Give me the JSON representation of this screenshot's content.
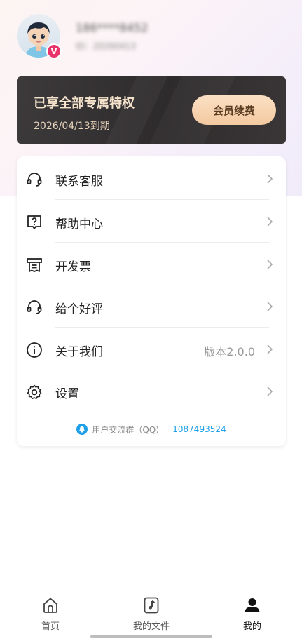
{
  "profile": {
    "username": "186****8452",
    "user_id": "ID：20260413",
    "vip_badge": "V"
  },
  "member_card": {
    "title": "已享全部专属特权",
    "expire": "2026/04/13到期",
    "renew_label": "会员续费"
  },
  "menu": {
    "items": [
      {
        "label": "联系客服",
        "icon": "headset-icon"
      },
      {
        "label": "帮助中心",
        "icon": "help-icon"
      },
      {
        "label": "开发票",
        "icon": "invoice-icon"
      },
      {
        "label": "给个好评",
        "icon": "headset-icon"
      },
      {
        "label": "关于我们",
        "icon": "info-icon",
        "value": "版本2.0.0"
      },
      {
        "label": "设置",
        "icon": "gear-icon"
      }
    ],
    "qq_group_label": "用户交流群（QQ）",
    "qq_group_number": "1087493524"
  },
  "bottom_nav": {
    "items": [
      {
        "label": "首页",
        "icon": "home-icon",
        "active": false
      },
      {
        "label": "我的文件",
        "icon": "music-file-icon",
        "active": false
      },
      {
        "label": "我的",
        "icon": "user-icon",
        "active": true
      }
    ]
  },
  "colors": {
    "accent_blue": "#1da0e8",
    "vip_pink": "#e8336b",
    "card_dark": "#332f30",
    "gold_text": "#f6e3cc"
  }
}
